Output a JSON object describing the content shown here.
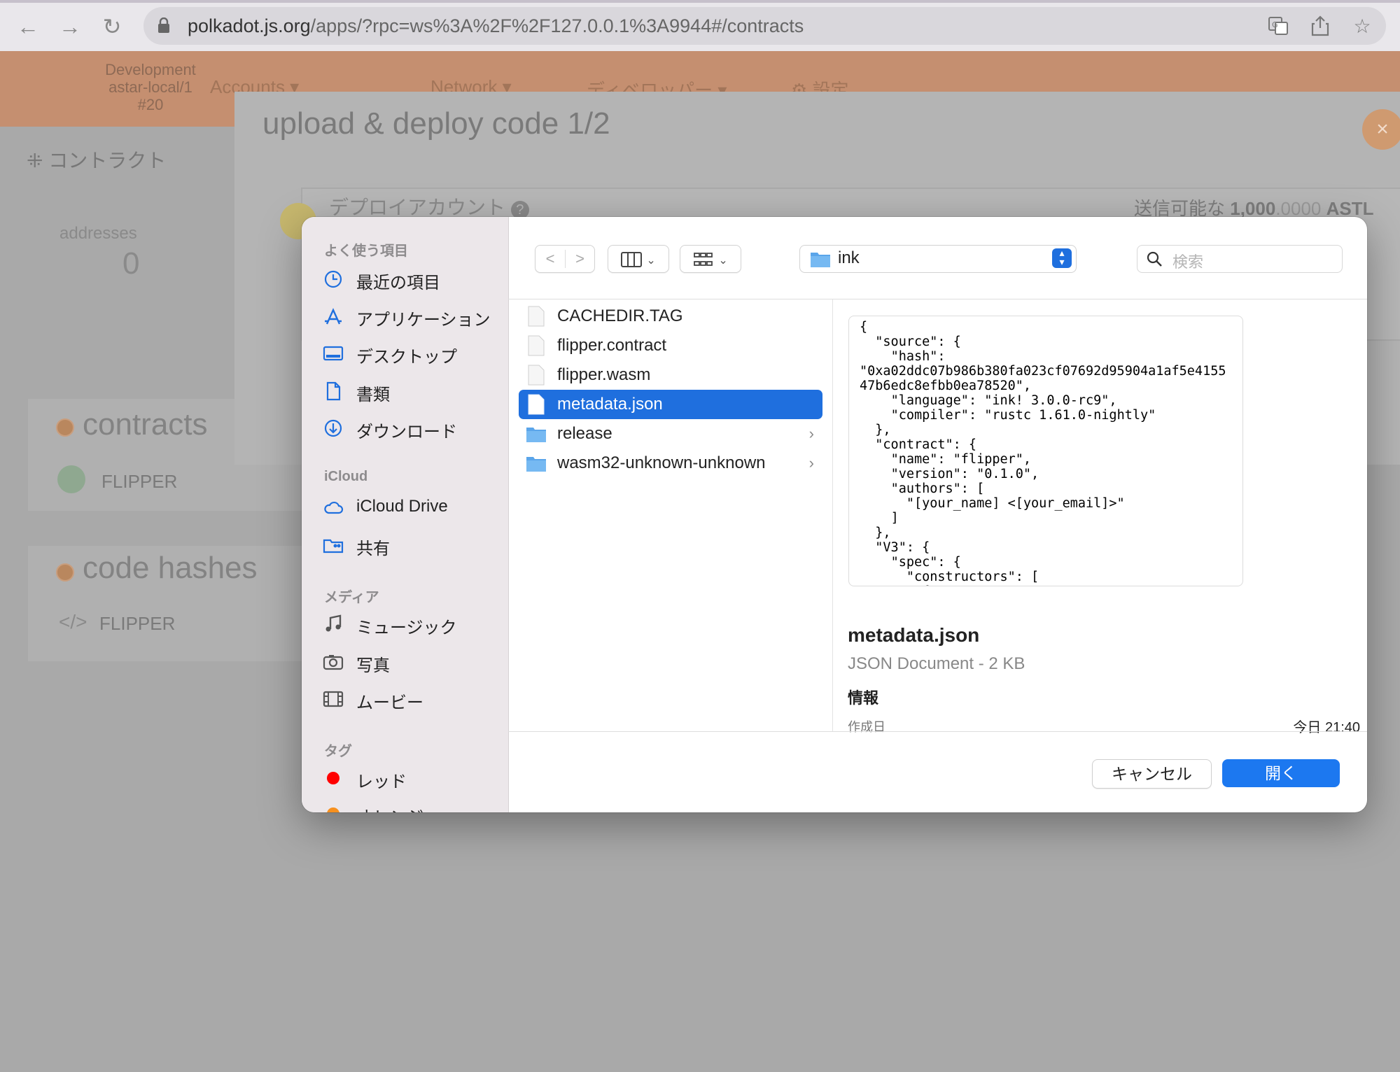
{
  "browser": {
    "url_host": "polkadot.js.org",
    "url_path": "/apps/?rpc=ws%3A%2F%2F127.0.0.1%3A9944#/contracts"
  },
  "app": {
    "dev_label": "Development",
    "node_label": "astar-local/1",
    "block_label": "#20",
    "nav": [
      "Accounts",
      "Network",
      "ディベロッパー",
      "設定"
    ],
    "subnav_contracts": "コントラクト",
    "addresses_label": "addresses",
    "addresses_count": "0",
    "contracts_title": "contracts",
    "contracts_item": "FLIPPER",
    "code_hashes_title": "code hashes",
    "code_hashes_item": "FLIPPER"
  },
  "deploy_modal": {
    "title": "upload & deploy code 1/2",
    "account_label": "デプロイアカウント",
    "balance_prefix": "送信可能な",
    "balance_int": "1,000",
    "balance_frac": ".0000",
    "balance_unit": "ASTL",
    "close_icon": "×"
  },
  "file_dialog": {
    "sidebar": {
      "favorites_header": "よく使う項目",
      "favorites": [
        "最近の項目",
        "アプリケーション",
        "デスクトップ",
        "書類",
        "ダウンロード"
      ],
      "icloud_header": "iCloud",
      "icloud": [
        "iCloud Drive",
        "共有"
      ],
      "media_header": "メディア",
      "media": [
        "ミュージック",
        "写真",
        "ムービー"
      ],
      "tags_header": "タグ",
      "tags": [
        "レッド",
        "オレンジ"
      ]
    },
    "location": "ink",
    "search_placeholder": "検索",
    "files": [
      {
        "name": "CACHEDIR.TAG",
        "type": "file"
      },
      {
        "name": "flipper.contract",
        "type": "file"
      },
      {
        "name": "flipper.wasm",
        "type": "file"
      },
      {
        "name": "metadata.json",
        "type": "file",
        "selected": true
      },
      {
        "name": "release",
        "type": "folder"
      },
      {
        "name": "wasm32-unknown-unknown",
        "type": "folder"
      }
    ],
    "preview_json": "{\n  \"source\": {\n    \"hash\":\n\"0xa02ddc07b986b380fa023cf07692d95904a1af5e415547b6edc8efbb0ea78520\",\n    \"language\": \"ink! 3.0.0-rc9\",\n    \"compiler\": \"rustc 1.61.0-nightly\"\n  },\n  \"contract\": {\n    \"name\": \"flipper\",\n    \"version\": \"0.1.0\",\n    \"authors\": [\n      \"[your_name] <[your_email]>\"\n    ]\n  },\n  \"V3\": {\n    \"spec\": {\n      \"constructors\": [\n        {",
    "preview_name": "metadata.json",
    "preview_kind": "JSON Document - 2 KB",
    "info_label": "情報",
    "created_label": "作成日",
    "created_value": "今日 21:40",
    "cancel_label": "キャンセル",
    "open_label": "開く"
  },
  "colors": {
    "accent_blue": "#1f6fde",
    "open_button": "#1c78f0",
    "app_header": "#c58f70",
    "tag_red": "#ff0000",
    "tag_orange": "#f7901e"
  }
}
